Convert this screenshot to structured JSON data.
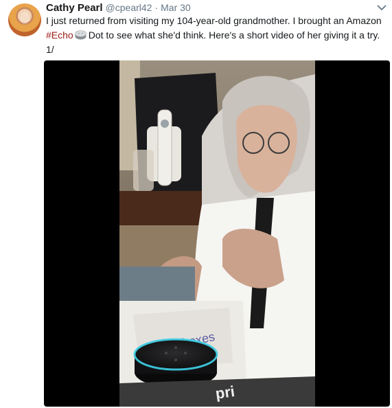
{
  "tweet": {
    "author_name": "Cathy Pearl",
    "handle": "@cpearl42",
    "separator": "·",
    "date": "Mar 30",
    "text_part1": "I just returned from visiting my 104-year-old grandmother. I brought an Amazon",
    "hashtag": "#Echo",
    "text_part2": "Dot to see what she'd think. Here's a short video of her giving it a try.",
    "text_part3": "1/"
  },
  "icons": {
    "caret": "chevron-down-icon",
    "emoji": "echo-dot-emoji"
  },
  "colors": {
    "hashtag": "#9b1c16",
    "muted": "#657786",
    "text": "#14171a",
    "video_background": "#000000",
    "echo_ring": "#3fd1e8"
  }
}
